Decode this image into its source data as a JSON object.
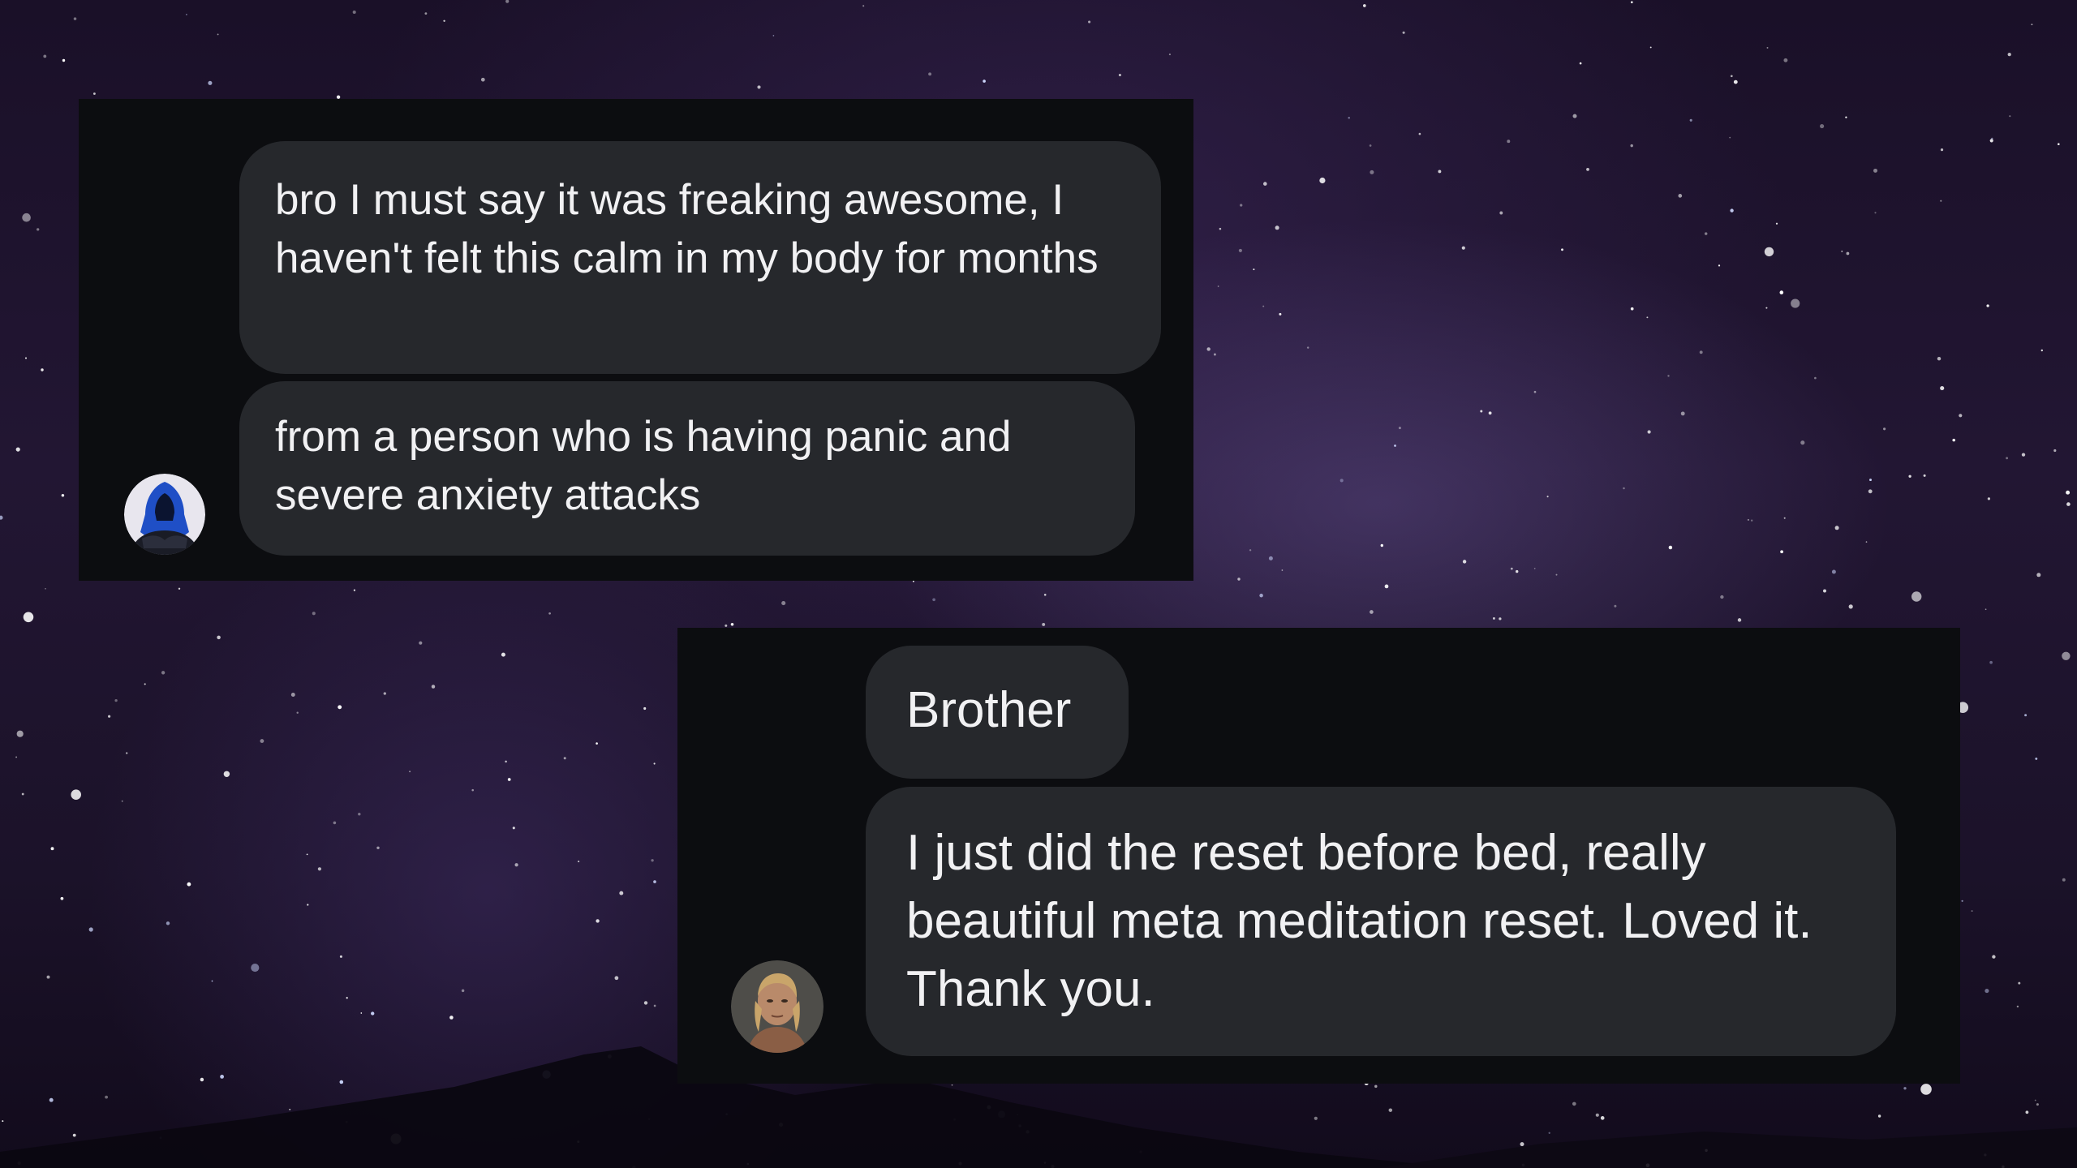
{
  "conversation_1": {
    "messages": [
      {
        "text": "bro I must say it was freaking awesome, I haven't felt this calm in my body for months"
      },
      {
        "text": "from a person who is having panic and severe anxiety attacks"
      }
    ],
    "avatar_icon": "hooded-figure-avatar"
  },
  "conversation_2": {
    "messages": [
      {
        "text": "Brother"
      },
      {
        "text": "I just did the reset before bed, really beautiful meta meditation reset. Loved it. Thank you."
      }
    ],
    "avatar_icon": "person-portrait-avatar"
  },
  "colors": {
    "panel_background": "#0c0d10",
    "bubble_background": "#26282c",
    "bubble_text": "#f1f1f3",
    "sky_background": "#1d1330"
  }
}
